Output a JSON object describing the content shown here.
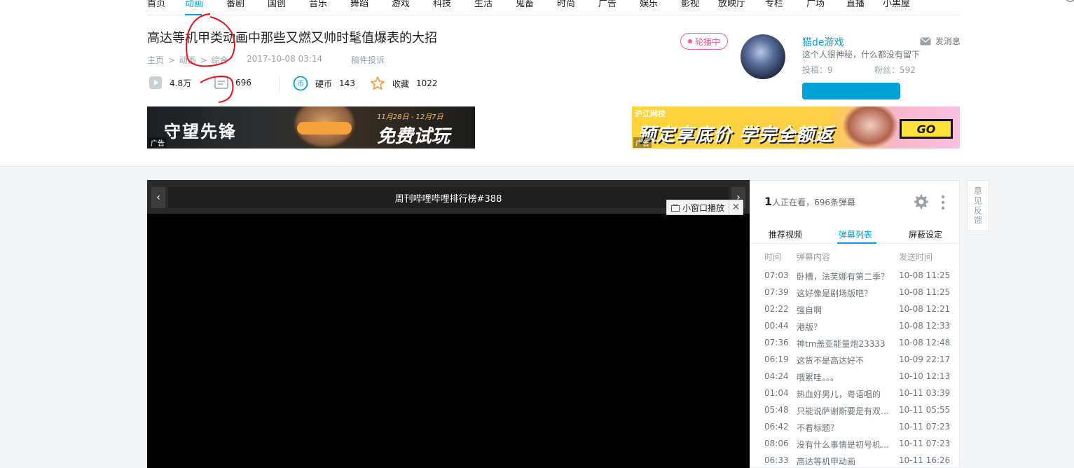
{
  "nav": {
    "items": [
      "首页",
      "动画",
      "番剧",
      "国创",
      "音乐",
      "舞蹈",
      "游戏",
      "科技",
      "生活",
      "鬼畜",
      "时尚",
      "广告",
      "娱乐",
      "影视",
      "放映厅",
      "专栏",
      "广场",
      "直播",
      "小黑屋"
    ],
    "active_index": 1
  },
  "video": {
    "title": "高达等机甲类动画中那些又燃又帅时髦值爆表的大招",
    "breadcrumb": [
      "主页",
      ">",
      "动画",
      ">",
      "综合"
    ],
    "publish_time": "2017-10-08 03:14",
    "report": "稿件投诉",
    "views": "4.8万",
    "danmaku_count": "696",
    "coins_label": "硬币",
    "coins": "143",
    "favorites_label": "收藏",
    "favorites": "1022"
  },
  "ads": {
    "tag": "广告",
    "left": {
      "title": "守望先锋",
      "date": "11月28日 - 12月7日",
      "cta": "免费试玩"
    },
    "right": {
      "brand": "沪江网校",
      "title": "预定享底价 学完全额返",
      "cta": "GO"
    }
  },
  "uploader": {
    "carousel": "轮播中",
    "name": "猫de游戏",
    "message": "发消息",
    "desc": "这个人很神秘，什么都没有留下",
    "posts": "投稿：9",
    "fans": "粉丝：592"
  },
  "player": {
    "title": "周刊哔哩哔哩排行榜#388",
    "mini_window": "小窗口播放",
    "prev": "‹",
    "next": "›",
    "close": "✕"
  },
  "danmaku_panel": {
    "watching_count": "1",
    "watching_suffix": "人正在看，696条弹幕",
    "tabs": [
      "推荐视频",
      "弹幕列表",
      "屏蔽设定"
    ],
    "active_tab": 1,
    "columns": [
      "时间",
      "弹幕内容",
      "发送时间"
    ],
    "rows": [
      [
        "07:03",
        "卧槽，法芙娜有第二季？",
        "10-08 11:25"
      ],
      [
        "07:39",
        "这好像是剧场版吧？",
        "10-08 11:25"
      ],
      [
        "02:22",
        "强自啊",
        "10-08 12:21"
      ],
      [
        "00:44",
        "港版？",
        "10-08 12:33"
      ],
      [
        "07:36",
        "神tm盖亚能量炮23333",
        "10-08 12:48"
      ],
      [
        "06:19",
        "这货不是高达好不",
        "10-09 22:17"
      ],
      [
        "04:24",
        "哦累哇。。。",
        "10-10 12:13"
      ],
      [
        "01:04",
        "热血好男儿，粤语唱的",
        "10-11 03:39"
      ],
      [
        "05:48",
        "只能说萨谢斯要是有双…",
        "10-11 05:55"
      ],
      [
        "06:42",
        "不看标题？",
        "10-11 07:23"
      ],
      [
        "08:06",
        "没有什么事情是初号机…",
        "10-11 07:23"
      ],
      [
        "06:33",
        "高达等机甲动画",
        "10-11 16:26"
      ]
    ]
  },
  "feedback": "意见反馈",
  "colors": {
    "accent": "#00a1d6",
    "pink": "#f25d8e",
    "annotation": "#e8101a"
  }
}
